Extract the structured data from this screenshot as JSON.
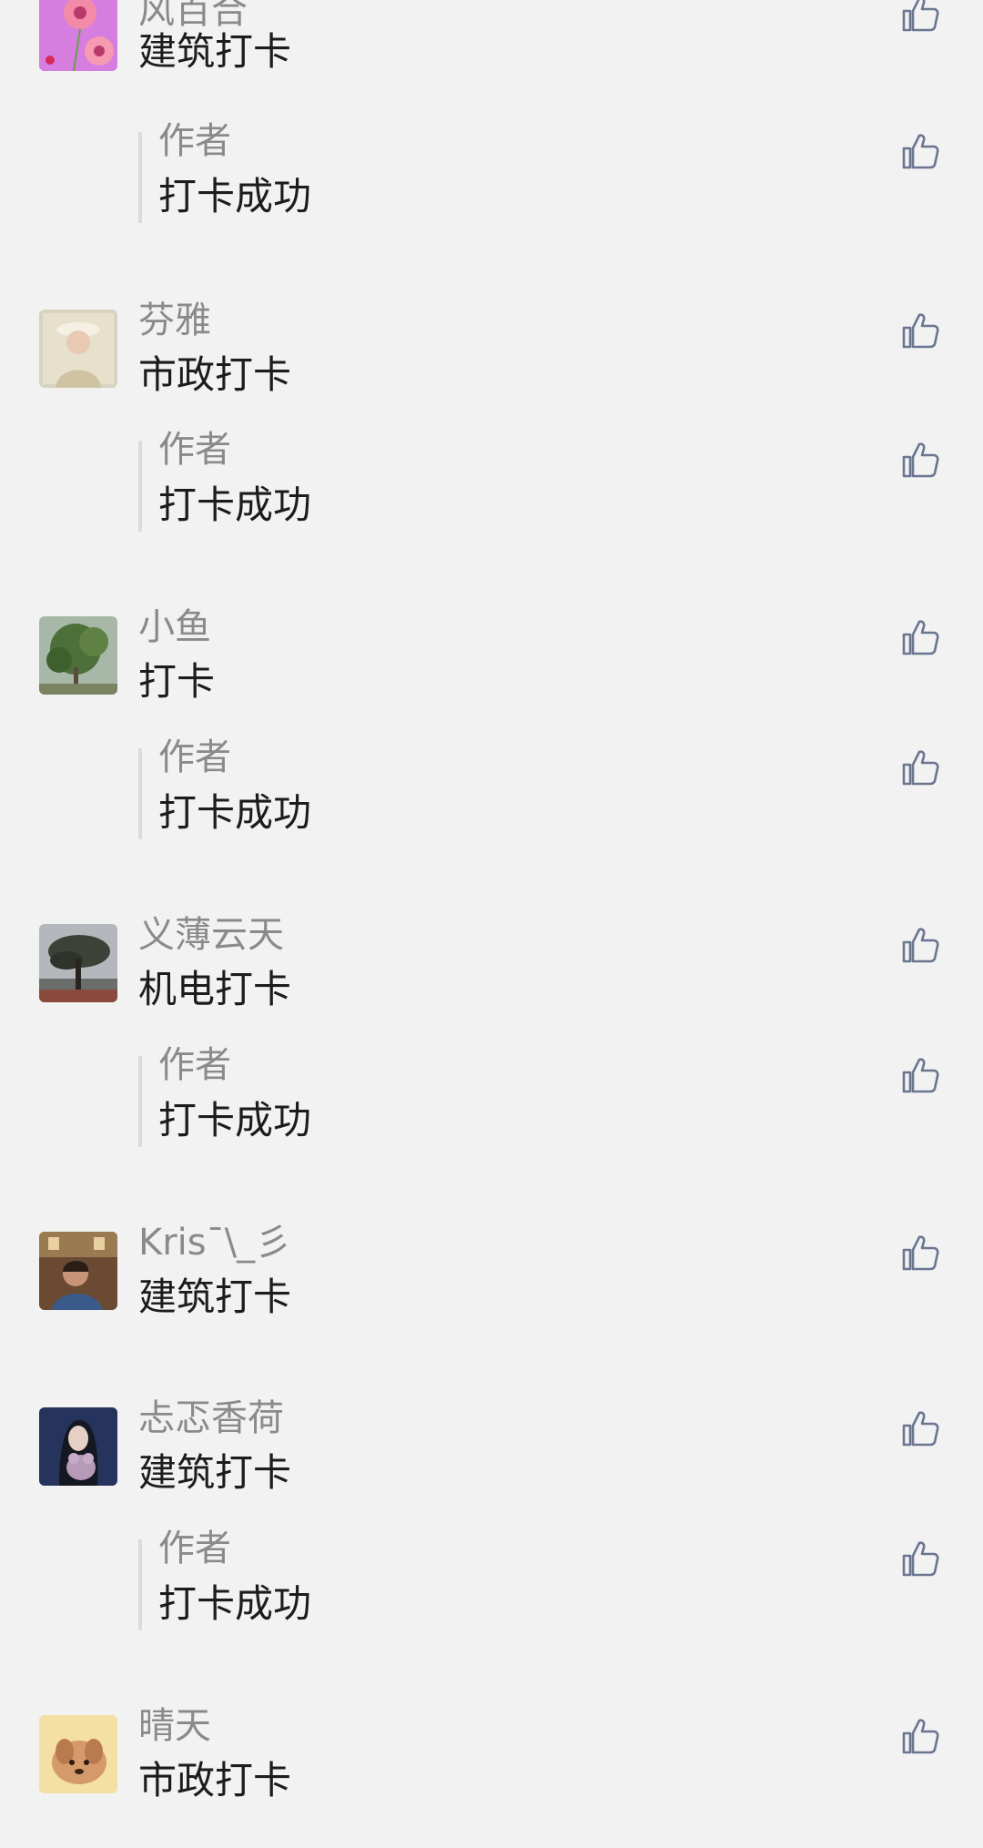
{
  "comments": [
    {
      "name": "风百合",
      "text": "建筑打卡",
      "reply": {
        "author": "作者",
        "text": "打卡成功"
      }
    },
    {
      "name": "芬雅",
      "text": "市政打卡",
      "reply": {
        "author": "作者",
        "text": "打卡成功"
      }
    },
    {
      "name": "小鱼",
      "text": "打卡",
      "reply": {
        "author": "作者",
        "text": "打卡成功"
      }
    },
    {
      "name": "义薄云天",
      "text": "机电打卡",
      "reply": {
        "author": "作者",
        "text": "打卡成功"
      }
    },
    {
      "name": "Kris¯\\_彡",
      "text": "建筑打卡"
    },
    {
      "name": "忐忑香荷",
      "text": "建筑打卡",
      "reply": {
        "author": "作者",
        "text": "打卡成功"
      }
    },
    {
      "name": "晴天",
      "text": "市政打卡"
    }
  ],
  "icons": {
    "like": "thumbs-up-icon"
  },
  "colors": {
    "background": "#f2f2f2",
    "name": "#8a8a8a",
    "text": "#1c1c1c",
    "like_icon": "#6a7690",
    "reply_bar": "#dcdcdc"
  }
}
